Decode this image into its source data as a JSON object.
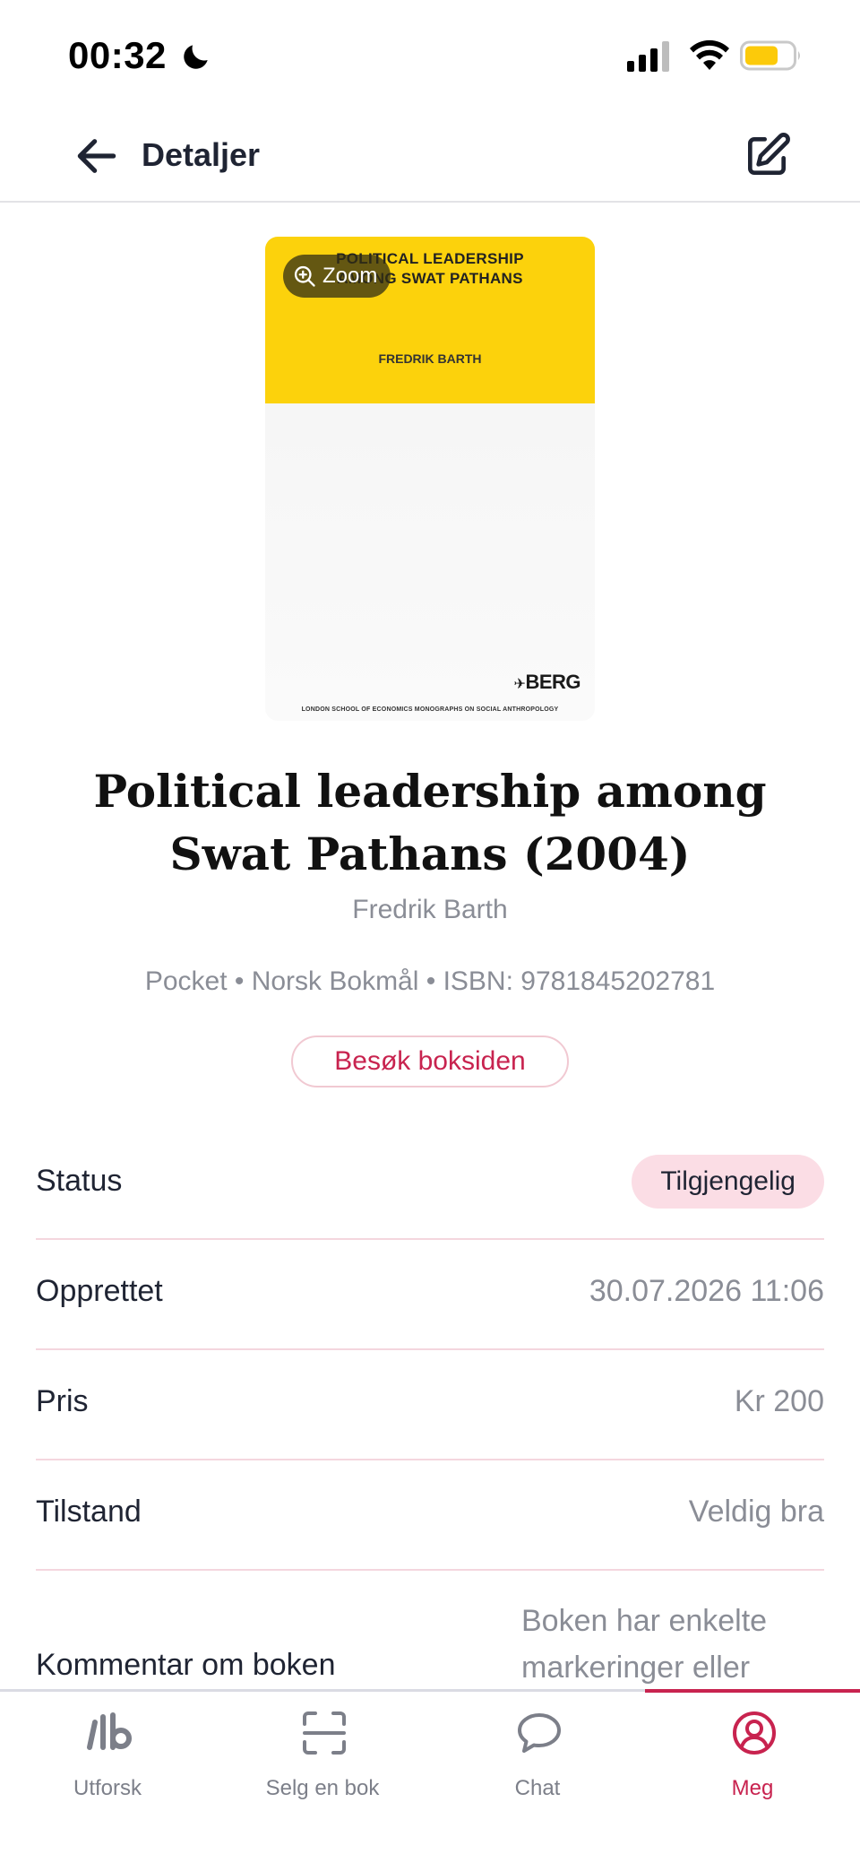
{
  "status_bar": {
    "time": "00:32"
  },
  "header": {
    "title": "Detaljer"
  },
  "cover": {
    "title_line1": "POLITICAL LEADERSHIP",
    "title_line2": "AMONG SWAT PATHANS",
    "author": "FREDRIK BARTH",
    "publisher": "BERG",
    "series": "LONDON SCHOOL OF ECONOMICS MONOGRAPHS ON SOCIAL ANTHROPOLOGY",
    "zoom_label": "Zoom"
  },
  "book": {
    "title": "Political leadership among Swat Pathans (2004)",
    "author": "Fredrik Barth",
    "meta": "Pocket • Norsk Bokmål • ISBN: 9781845202781",
    "visit_label": "Besøk boksiden"
  },
  "details": {
    "status_label": "Status",
    "status_value": "Tilgjengelig",
    "created_label": "Opprettet",
    "created_value": "30.07.2026 11:06",
    "price_label": "Pris",
    "price_value": "Kr 200",
    "condition_label": "Tilstand",
    "condition_value": "Veldig bra",
    "comment_label": "Kommentar om boken",
    "comment_value": "Boken har enkelte markeringer eller"
  },
  "tabbar": {
    "tabs": [
      {
        "label": "Utforsk",
        "icon": "logo-icon"
      },
      {
        "label": "Selg en bok",
        "icon": "scan-icon"
      },
      {
        "label": "Chat",
        "icon": "chat-icon"
      },
      {
        "label": "Meg",
        "icon": "profile-icon"
      }
    ],
    "active": "Meg",
    "accent_color": "#c8234f"
  }
}
